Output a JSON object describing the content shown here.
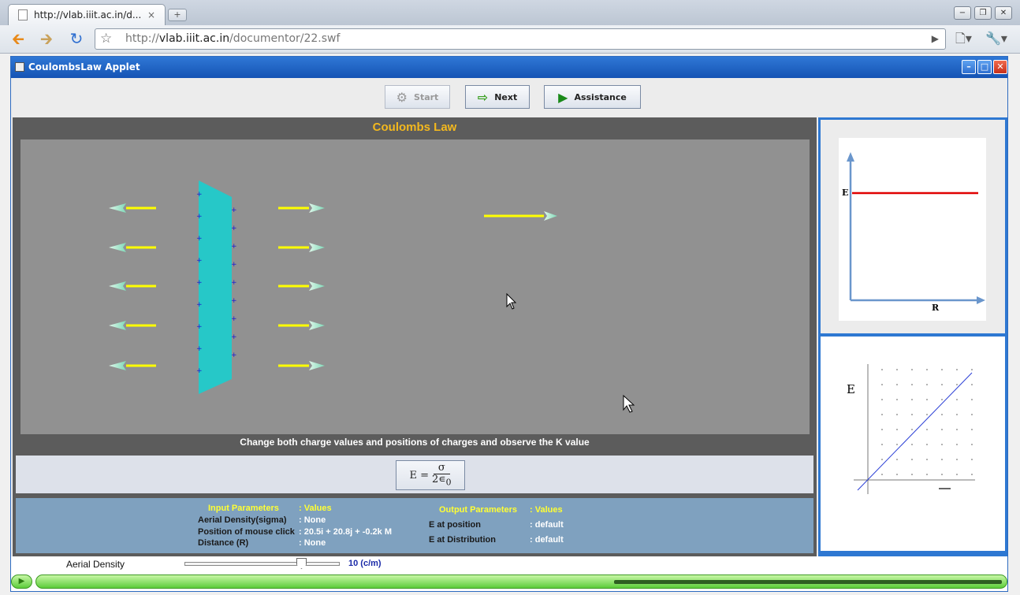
{
  "browser": {
    "tab_title": "http://vlab.iiit.ac.in/d...",
    "tab_close": "×",
    "new_tab": "+",
    "url_scheme": "http://",
    "url_host": "vlab.iiit.ac.in",
    "url_path": "/documentor/22.swf",
    "window_buttons": [
      "−",
      "❐",
      "✕"
    ]
  },
  "applet": {
    "title": "CoulombsLaw Applet",
    "buttons": {
      "start": "Start",
      "next": "Next",
      "assistance": "Assistance"
    },
    "main_title": "Coulombs Law",
    "instruction": "Change both charge values and positions of charges and observe the K value",
    "formula": {
      "lhs": "E =",
      "numerator": "σ",
      "denominator": "2∊",
      "denominator_sub": "0"
    },
    "input_params": {
      "header": "Input Parameters",
      "header_value": ": Values",
      "rows": [
        {
          "label": "Aerial Density(sigma)",
          "value": ": None"
        },
        {
          "label": "Position of mouse click",
          "value": ": 20.5i + 20.8j + -0.2k  M"
        },
        {
          "label": "Distance (R)",
          "value": ": None"
        }
      ]
    },
    "output_params": {
      "header": "Output Parameters",
      "header_value": ": Values",
      "rows": [
        {
          "label": "E at position",
          "value": ": default"
        },
        {
          "label": "E at Distribution",
          "value": ":  default"
        }
      ]
    },
    "graph1": {
      "y_label": "E",
      "x_label": "R"
    },
    "graph2": {
      "y_label": "E"
    },
    "slider": {
      "label": "Aerial Density",
      "value_text": "10 (c/m)",
      "fraction": 0.75
    },
    "progress": {
      "fraction": 0.59
    },
    "colors": {
      "title_accent": "#f3b81e",
      "plate": "#26c8c8",
      "field_line": "#ffff00",
      "graph_line": "#e00000"
    }
  }
}
